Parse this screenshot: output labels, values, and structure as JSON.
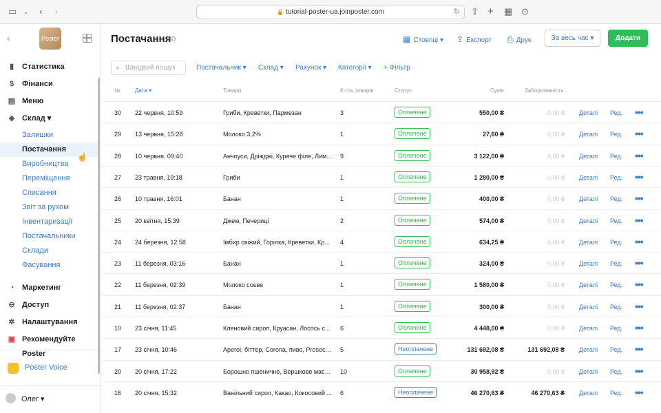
{
  "browser": {
    "url": "tutorial-poster-ua.joinposter.com"
  },
  "sidebar": {
    "logo_text": "Poster",
    "items": [
      {
        "label": "Статистика",
        "icon": "chart-icon",
        "sub": false
      },
      {
        "label": "Фінанси",
        "icon": "dollar-icon",
        "sub": false
      },
      {
        "label": "Меню",
        "icon": "menu-icon",
        "sub": false
      },
      {
        "label": "Склад ▾",
        "icon": "layers-icon",
        "sub": false
      },
      {
        "label": "Залишки",
        "sub": true
      },
      {
        "label": "Постачання",
        "sub": true,
        "active": true
      },
      {
        "label": "Виробництва",
        "sub": true
      },
      {
        "label": "Переміщення",
        "sub": true
      },
      {
        "label": "Списання",
        "sub": true
      },
      {
        "label": "Звіт за рухом",
        "sub": true
      },
      {
        "label": "Інвентаризації",
        "sub": true
      },
      {
        "label": "Постачальники",
        "sub": true
      },
      {
        "label": "Склади",
        "sub": true
      },
      {
        "label": "Фасування",
        "sub": true
      },
      {
        "label": "Маркетинг",
        "icon": "marketing-icon",
        "sub": false
      },
      {
        "label": "Доступ",
        "icon": "lock-icon",
        "sub": false
      },
      {
        "label": "Налаштування",
        "icon": "gear-icon",
        "sub": false
      },
      {
        "label": "Рекомендуйте Poster",
        "icon": "gift-icon",
        "sub": false
      }
    ],
    "voice": "Poster Voice",
    "user": "Олег ▾"
  },
  "header": {
    "title": "Постачання",
    "count": "30",
    "columns_btn": "Стовпці ▾",
    "export_btn": "Експорт",
    "print_btn": "Друк",
    "period": "За весь час ▾",
    "add_btn": "Додати"
  },
  "filters": {
    "search_placeholder": "Швидкий пошук",
    "items": [
      "Постачальник ▾",
      "Склад ▾",
      "Рахунок ▾",
      "Категорії ▾",
      "+ Фільтр"
    ]
  },
  "table": {
    "headers": [
      "№",
      "Дата ▾",
      "Товари",
      "К-сть товарів",
      "Статус",
      "Сума",
      "Заборгованість"
    ],
    "detail_label": "Деталі",
    "edit_label": "Ред.",
    "more_label": "•••",
    "rows": [
      {
        "num": "30",
        "date": "22 червня, 10:59",
        "goods": "Гриби, Креветки, Пармезан",
        "qty": "3",
        "status": "Оплачене",
        "paid": true,
        "sum": "550,00 ₴",
        "debt": "0,00 ₴"
      },
      {
        "num": "29",
        "date": "13 червня, 15:28",
        "goods": "Молоко 3,2%",
        "qty": "1",
        "status": "Оплачене",
        "paid": true,
        "sum": "27,60 ₴",
        "debt": "0,00 ₴"
      },
      {
        "num": "28",
        "date": "10 червня, 09:40",
        "goods": "Анчоуси, Дріжджі, Куряче філе, Лим...",
        "qty": "9",
        "status": "Оплачене",
        "paid": true,
        "sum": "3 122,00 ₴",
        "debt": "0,00 ₴"
      },
      {
        "num": "27",
        "date": "23 травня, 19:18",
        "goods": "Гриби",
        "qty": "1",
        "status": "Оплачене",
        "paid": true,
        "sum": "1 280,00 ₴",
        "debt": "0,00 ₴"
      },
      {
        "num": "26",
        "date": "10 травня, 16:01",
        "goods": "Банан",
        "qty": "1",
        "status": "Оплачене",
        "paid": true,
        "sum": "400,00 ₴",
        "debt": "0,00 ₴"
      },
      {
        "num": "25",
        "date": "20 квітня, 15:39",
        "goods": "Джем, Печериці",
        "qty": "2",
        "status": "Оплачене",
        "paid": true,
        "sum": "574,00 ₴",
        "debt": "0,00 ₴"
      },
      {
        "num": "24",
        "date": "24 березня, 12:58",
        "goods": "Імбир свіжий, Горілка, Креветки, Кр...",
        "qty": "4",
        "status": "Оплачене",
        "paid": true,
        "sum": "634,25 ₴",
        "debt": "0,00 ₴"
      },
      {
        "num": "23",
        "date": "11 березня, 03:16",
        "goods": "Банан",
        "qty": "1",
        "status": "Оплачене",
        "paid": true,
        "sum": "324,00 ₴",
        "debt": "0,00 ₴"
      },
      {
        "num": "22",
        "date": "11 березня, 02:39",
        "goods": "Молоко соєве",
        "qty": "1",
        "status": "Оплачене",
        "paid": true,
        "sum": "1 580,00 ₴",
        "debt": "0,00 ₴"
      },
      {
        "num": "21",
        "date": "11 березня, 02:37",
        "goods": "Банан",
        "qty": "1",
        "status": "Оплачене",
        "paid": true,
        "sum": "300,00 ₴",
        "debt": "0,00 ₴"
      },
      {
        "num": "10",
        "date": "23 січня, 11:45",
        "goods": "Кленовий сироп, Круасан, Лосось с...",
        "qty": "6",
        "status": "Оплачене",
        "paid": true,
        "sum": "4 448,00 ₴",
        "debt": "0,00 ₴"
      },
      {
        "num": "17",
        "date": "23 січня, 10:46",
        "goods": "Aperol, біттер, Corona, пиво, Prosecc...",
        "qty": "5",
        "status": "Неоплачене",
        "paid": false,
        "sum": "131 692,08 ₴",
        "debt": "131 692,08 ₴"
      },
      {
        "num": "20",
        "date": "20 січня, 17:22",
        "goods": "Борошно пшеничне, Вершкове масл...",
        "qty": "10",
        "status": "Оплачене",
        "paid": true,
        "sum": "30 958,92 ₴",
        "debt": "0,00 ₴"
      },
      {
        "num": "16",
        "date": "20 січня, 15:32",
        "goods": "Ванільний сироп, Какао, Кокосовий ...",
        "qty": "6",
        "status": "Неоплачене",
        "paid": false,
        "sum": "46 270,63 ₴",
        "debt": "46 270,63 ₴"
      }
    ]
  }
}
